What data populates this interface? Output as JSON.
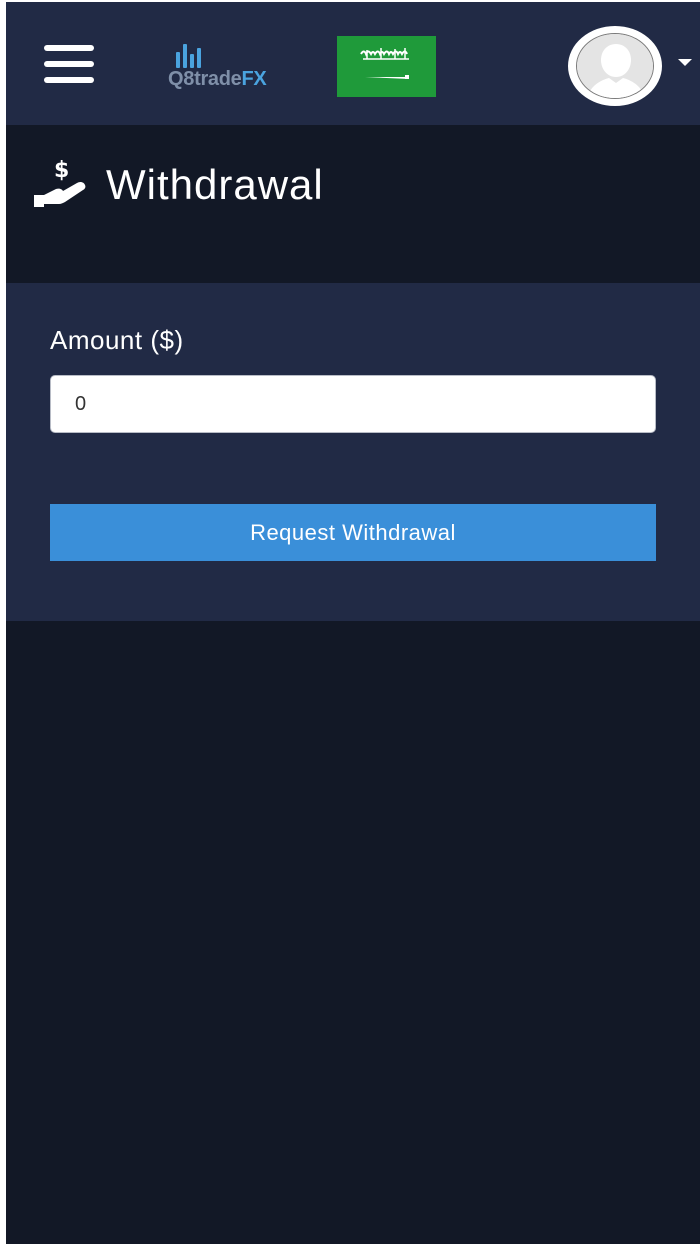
{
  "brand": {
    "logo_text_primary": "Q8trade",
    "logo_text_accent": "FX",
    "colors": {
      "primary": "#7f8fa8",
      "accent": "#4aa3df"
    }
  },
  "topbar": {
    "menu_icon": "hamburger-menu-icon",
    "language_flag": "saudi-arabia-flag",
    "avatar_icon": "user-avatar-icon",
    "dropdown_icon": "caret-down-icon"
  },
  "page": {
    "title": "Withdrawal",
    "title_icon": "hand-dollar-icon"
  },
  "form": {
    "amount_label": "Amount ($)",
    "amount_value": "0",
    "submit_label": "Request Withdrawal"
  },
  "colors": {
    "topbar_bg": "#212a45",
    "page_bg": "#121826",
    "button": "#3a8fd9",
    "flag_green": "#1f9a3a"
  }
}
